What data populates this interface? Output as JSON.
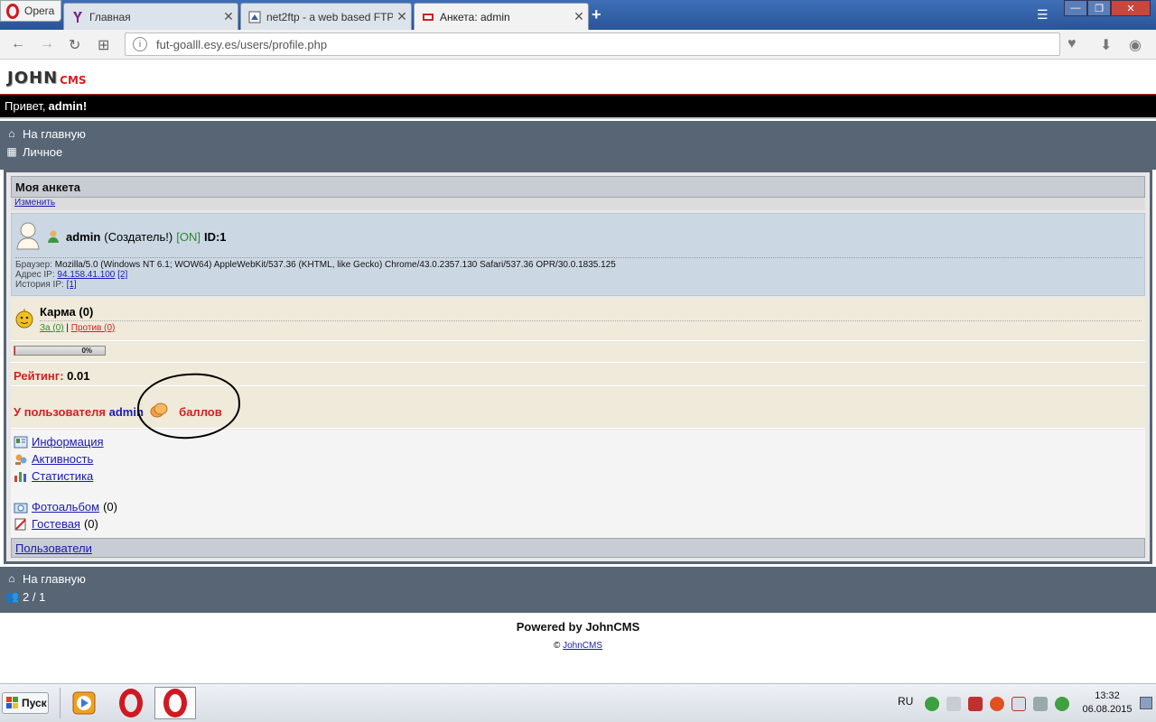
{
  "browser": {
    "menu_label": "Opera",
    "tabs": [
      {
        "title": "Главная"
      },
      {
        "title": "net2ftp - a web based FTP"
      },
      {
        "title": "Анкета: admin"
      }
    ],
    "address": "fut-goalll.esy.es/users/profile.php"
  },
  "site": {
    "logo_main": "JOHN",
    "logo_sub": "CMS",
    "greeting": "Привет,",
    "greeting_user": "admin!"
  },
  "top_nav": {
    "home": "На главную",
    "personal": "Личное"
  },
  "profile": {
    "header": "Моя анкета",
    "edit_link": "Изменить",
    "username": "admin",
    "role": "(Создатель!)",
    "status": "[ON]",
    "id": "ID:1",
    "browser_label": "Браузер:",
    "browser_value": "Mozilla/5.0 (Windows NT 6.1; WOW64) AppleWebKit/537.36 (KHTML, like Gecko) Chrome/43.0.2357.130 Safari/537.36 OPR/30.0.1835.125",
    "ip_label": "Адрес IP:",
    "ip_value": "94.158.41.100",
    "ip_count": "[2]",
    "ip_history_label": "История IP:",
    "ip_history_value": "[1]",
    "karma_title": "Карма (0)",
    "karma_for": "За (0)",
    "karma_sep": "|",
    "karma_against": "Против (0)",
    "progress_label": "0%",
    "progress": 0,
    "rating_label": "Рейтинг:",
    "rating_value": "0.01",
    "points_prefix": "У пользователя",
    "points_user": "admin",
    "points_suffix": "баллов"
  },
  "profile_menu": [
    {
      "label": "Информация",
      "count": ""
    },
    {
      "label": "Активность",
      "count": ""
    },
    {
      "label": "Статистика",
      "count": ""
    },
    {
      "label": "Фотоальбом",
      "count": "(0)"
    },
    {
      "label": "Гостевая",
      "count": "(0)"
    }
  ],
  "users_link": "Пользователи",
  "bottom_nav": {
    "home": "На главную",
    "online": "2 / 1"
  },
  "footer": {
    "powered": "Powered by JohnCMS",
    "copyright_symbol": "©",
    "copyright_link": "JohnCMS"
  },
  "taskbar": {
    "start": "Пуск",
    "lang": "RU",
    "time": "13:32",
    "date": "06.08.2015"
  },
  "colors": {
    "accent_red": "#d42020",
    "link_blue": "#1a1ab4",
    "panel_dark": "#576575",
    "online_green": "#2a8a2a"
  }
}
